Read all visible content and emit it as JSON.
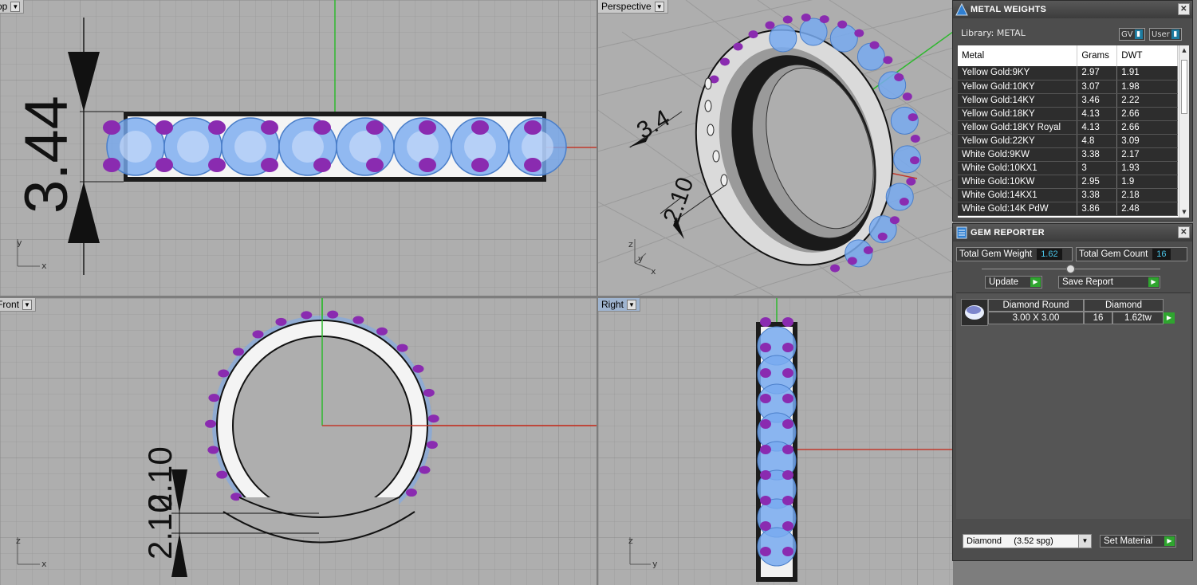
{
  "viewports": {
    "top": {
      "label": "Top"
    },
    "perspective": {
      "label": "Perspective"
    },
    "front": {
      "label": "Front"
    },
    "right": {
      "label": "Right"
    },
    "dimensions": {
      "top_height": "3.44",
      "front_thickness": "2.10",
      "persp_height": "3.4",
      "persp_thickness": "2.10"
    },
    "axes": {
      "x": "x",
      "y": "y",
      "z": "z"
    }
  },
  "metal_weights": {
    "title": "METAL WEIGHTS",
    "library_label": "Library: METAL",
    "toggle_gv": "GV",
    "toggle_user": "User",
    "columns": [
      "Metal",
      "Grams",
      "DWT"
    ],
    "rows": [
      [
        "Yellow Gold:9KY",
        "2.97",
        "1.91"
      ],
      [
        "Yellow Gold:10KY",
        "3.07",
        "1.98"
      ],
      [
        "Yellow Gold:14KY",
        "3.46",
        "2.22"
      ],
      [
        "Yellow Gold:18KY",
        "4.13",
        "2.66"
      ],
      [
        "Yellow Gold:18KY Royal",
        "4.13",
        "2.66"
      ],
      [
        "Yellow Gold:22KY",
        "4.8",
        "3.09"
      ],
      [
        "White Gold:9KW",
        "3.38",
        "2.17"
      ],
      [
        "White Gold:10KX1",
        "3",
        "1.93"
      ],
      [
        "White Gold:10KW",
        "2.95",
        "1.9"
      ],
      [
        "White Gold:14KX1",
        "3.38",
        "2.18"
      ],
      [
        "White Gold:14K PdW",
        "3.86",
        "2.48"
      ]
    ]
  },
  "gem_reporter": {
    "title": "GEM REPORTER",
    "total_weight_label": "Total Gem Weight",
    "total_weight_value": "1.62",
    "total_count_label": "Total Gem Count",
    "total_count_value": "16",
    "update_label": "Update",
    "save_report_label": "Save Report",
    "gem": {
      "name": "Diamond Round",
      "type": "Diamond",
      "size": "3.00 X 3.00",
      "count": "16",
      "weight": "1.62tw"
    },
    "material_select": "Diamond     (3.52 spg)",
    "set_material_label": "Set Material"
  },
  "colors": {
    "viewport_bg": "#aeaeae",
    "gem": "#78aaf0",
    "prong": "#8a2bb0",
    "x_axis": "#c0392b",
    "y_axis": "#2eb82e"
  }
}
